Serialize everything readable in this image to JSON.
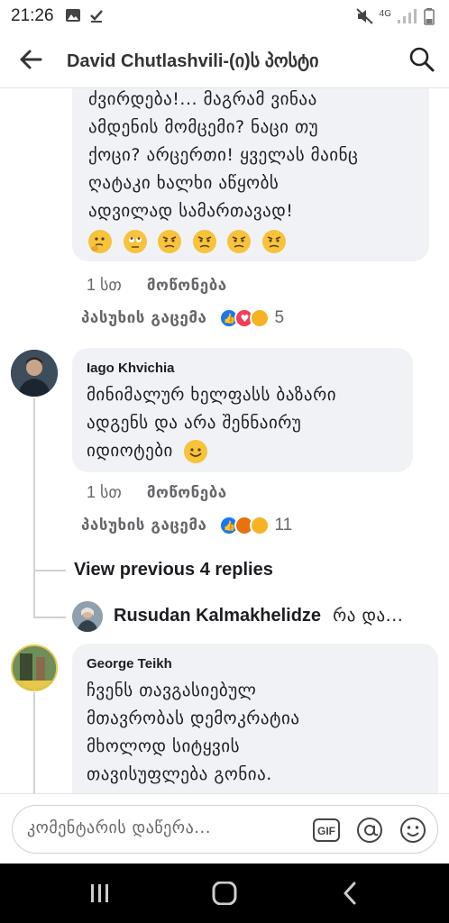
{
  "status_bar": {
    "time": "21:26",
    "network": "4G"
  },
  "header": {
    "title": "David Chutlashvili-(ი)ს პოსტი"
  },
  "comments": [
    {
      "lines": [
        "ძვირდება!... მაგრამ ვინაა",
        "ამდენის მომცემი? ნაცი თუ",
        "ქოცი? არცერთი! ყველას მაინც",
        "ღატაკი ხალხი აწყობს",
        "ადვილად სამართავად!"
      ],
      "emojis": [
        "thinking-face",
        "eye-roll-face",
        "angry-face",
        "angry-face",
        "angry-face",
        "angry-face"
      ],
      "time": "1 სთ",
      "like_label": "მოწონება",
      "reply_label": "პასუხის გაცემა",
      "reactions": [
        "like",
        "love",
        "care"
      ],
      "reaction_count": "5"
    },
    {
      "author": "Iago Khvichia",
      "lines": [
        "მინიმალურ ხელფასს ბაზარი",
        "ადგენს და არა შენნაირუ",
        "იდიოტები"
      ],
      "emoji": "smiling-face",
      "time": "1 სთ",
      "like_label": "მოწონება",
      "reply_label": "პასუხის გაცემა",
      "reactions": [
        "like",
        "angry",
        "sad"
      ],
      "reaction_count": "11",
      "view_previous": "View previous 4 replies",
      "reply_preview": {
        "author": "Rusudan Kalmakhelidze",
        "text": "რა და..."
      }
    },
    {
      "author": "George Teikh",
      "lines": [
        "ჩვენს თავგასიებულ",
        "მთავრობას  დემოკრატია",
        "მხოლოდ სიტყვის",
        "თავისუფლება გონია."
      ]
    }
  ],
  "composer": {
    "placeholder": "კომენტარის დაწერა...",
    "gif_label": "GIF"
  },
  "colors": {
    "accent": "#1877f2",
    "bubble": "#f0f2f5",
    "secondary_text": "#65676b"
  }
}
